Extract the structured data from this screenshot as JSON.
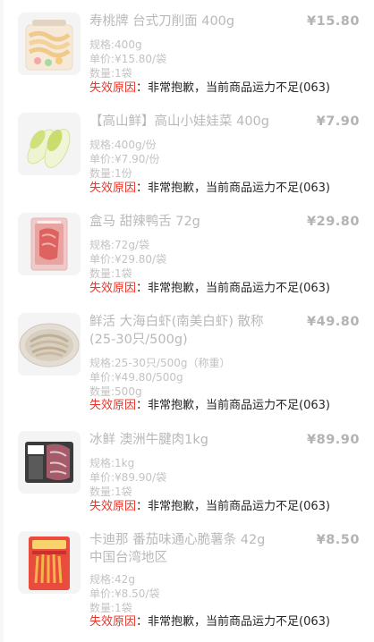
{
  "items": [
    {
      "name": "寿桃牌 台式刀削面 400g",
      "price": "¥15.80",
      "spec": "规格:400g",
      "unit_price": "单价:¥15.80/袋",
      "quantity": "数量:1袋",
      "reason_label": "失效原因",
      "reason_text": "：非常抱歉，当前商品运力不足(063)"
    },
    {
      "name": "【高山鲜】高山小娃娃菜 400g",
      "price": "¥7.90",
      "spec": "规格:400g/份",
      "unit_price": "单价:¥7.90/份",
      "quantity": "数量:1份",
      "reason_label": "失效原因",
      "reason_text": "：非常抱歉，当前商品运力不足(063)"
    },
    {
      "name": "盒马 甜辣鸭舌 72g",
      "price": "¥29.80",
      "spec": "规格:72g/袋",
      "unit_price": "单价:¥29.80/袋",
      "quantity": "数量:1袋",
      "reason_label": "失效原因",
      "reason_text": "：非常抱歉，当前商品运力不足(063)"
    },
    {
      "name_line1": "鲜活 大海白虾(南美白虾) 散称",
      "name_line2": "(25-30只/500g)",
      "price": "¥49.80",
      "spec": "规格:25-30只/500g（称重）",
      "unit_price": "单价:¥49.80/500g",
      "quantity": "数量:500g",
      "reason_label": "失效原因",
      "reason_text": "：非常抱歉，当前商品运力不足(063)"
    },
    {
      "name": "冰鲜 澳洲牛腱肉1kg",
      "price": "¥89.90",
      "spec": "规格:1kg",
      "unit_price": "单价:¥89.90/袋",
      "quantity": "数量:1袋",
      "reason_label": "失效原因",
      "reason_text": "：非常抱歉，当前商品运力不足(063)"
    },
    {
      "name_line1": "卡迪那 番茄味通心脆薯条 42g",
      "name_line2": "中国台湾地区",
      "price": "¥8.50",
      "spec": "规格:42g",
      "unit_price": "单价:¥8.50/袋",
      "quantity": "数量:1袋",
      "reason_label": "失效原因",
      "reason_text": "：非常抱歉，当前商品运力不足(063)"
    }
  ]
}
